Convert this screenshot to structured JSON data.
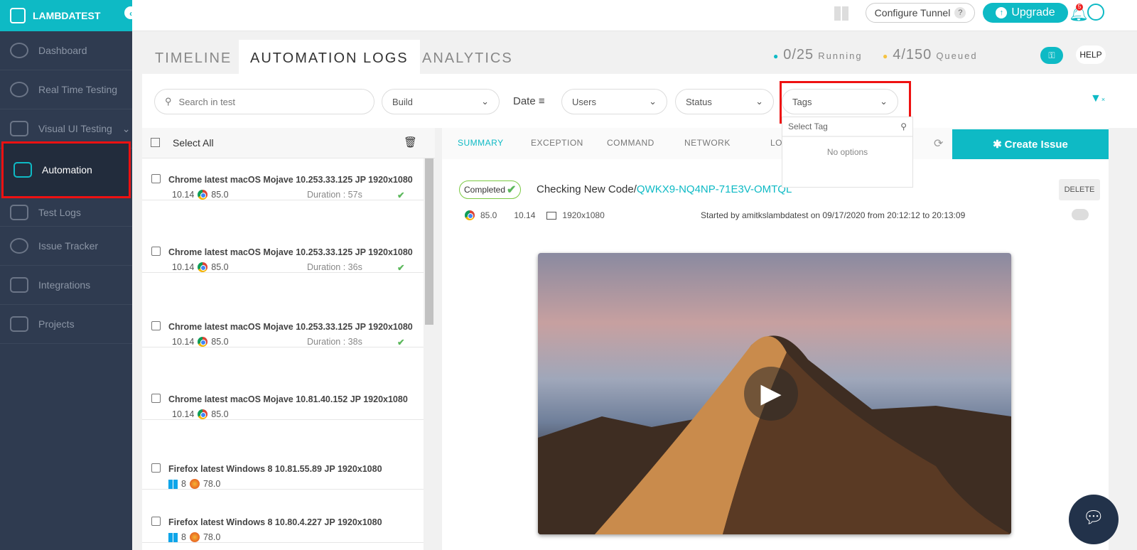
{
  "brand": "LAMBDATEST",
  "sidebar": {
    "items": [
      {
        "label": "Dashboard"
      },
      {
        "label": "Real Time Testing"
      },
      {
        "label": "Visual UI Testing"
      },
      {
        "label": "Automation"
      },
      {
        "label": "Test Logs"
      },
      {
        "label": "Issue Tracker"
      },
      {
        "label": "Integrations"
      },
      {
        "label": "Projects"
      }
    ]
  },
  "topbar": {
    "configure_tunnel": "Configure Tunnel",
    "help_q": "?",
    "upgrade": "Upgrade",
    "notif_count": "5"
  },
  "tabs": [
    {
      "label": "TIMELINE"
    },
    {
      "label": "AUTOMATION LOGS"
    },
    {
      "label": "ANALYTICS"
    }
  ],
  "stats": {
    "running": "0/25",
    "running_label": "Running",
    "queued": "4/150",
    "queued_label": "Queued",
    "help": "HELP"
  },
  "filters": {
    "search_placeholder": "Search in test",
    "build": "Build",
    "date": "Date",
    "users": "Users",
    "status": "Status",
    "tags": "Tags",
    "tag_search_placeholder": "Select Tag",
    "no_options": "No options"
  },
  "list": {
    "select_all": "Select All",
    "rows": [
      {
        "title": "Chrome latest macOS Mojave 10.253.33.125 JP 1920x1080",
        "os": "10.14",
        "browser": "85.0",
        "duration": "Duration : 57s"
      },
      {
        "title": "Chrome latest macOS Mojave 10.253.33.125 JP 1920x1080",
        "os": "10.14",
        "browser": "85.0",
        "duration": "Duration : 36s"
      },
      {
        "title": "Chrome latest macOS Mojave 10.253.33.125 JP 1920x1080",
        "os": "10.14",
        "browser": "85.0",
        "duration": "Duration : 38s"
      },
      {
        "title": "Chrome latest macOS Mojave 10.81.40.152 JP 1920x1080",
        "os": "10.14",
        "browser": "85.0",
        "duration": ""
      },
      {
        "title": "Firefox latest Windows 8 10.81.55.89 JP 1920x1080",
        "os": "8",
        "browser": "78.0",
        "duration": ""
      },
      {
        "title": "Firefox latest Windows 8 10.80.4.227 JP 1920x1080",
        "os": "8",
        "browser": "78.0",
        "duration": ""
      }
    ]
  },
  "detail": {
    "tabs": [
      "SUMMARY",
      "EXCEPTION",
      "COMMAND",
      "NETWORK",
      "LO"
    ],
    "create_issue": "Create Issue",
    "status": "Completed",
    "name": "Checking New Code/",
    "test_id": "QWKX9-NQ4NP-71E3V-OMTQL",
    "delete": "DELETE",
    "browser": "85.0",
    "os": "10.14",
    "resolution": "1920x1080",
    "started": "Started by amitkslambdatest on 09/17/2020 from 20:12:12 to 20:13:09"
  }
}
